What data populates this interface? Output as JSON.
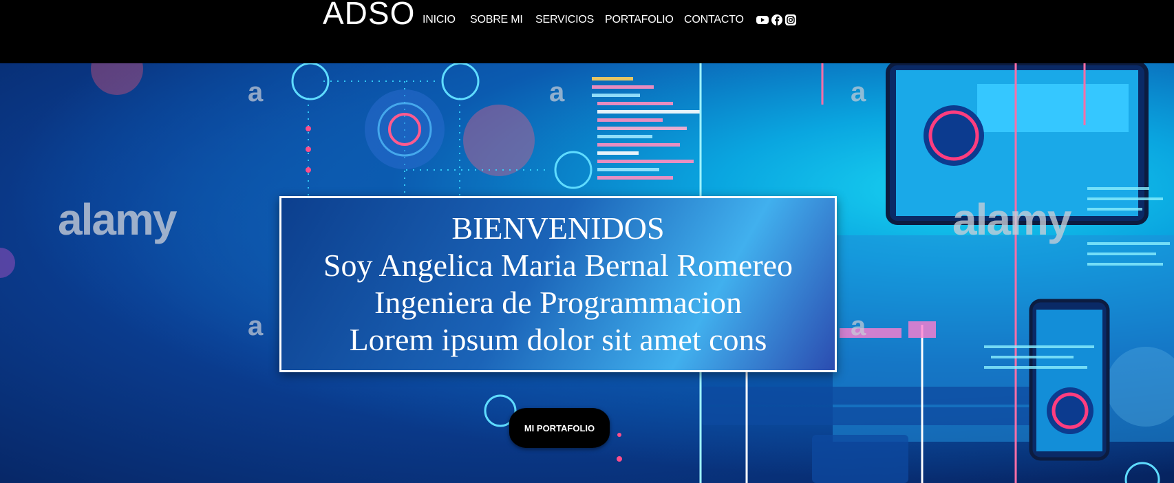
{
  "header": {
    "logo": "ADSO",
    "nav": [
      {
        "label": "INICIO"
      },
      {
        "label": "SOBRE MI"
      },
      {
        "label": "SERVICIOS"
      },
      {
        "label": "PORTAFOLIO"
      },
      {
        "label": "CONTACTO"
      }
    ],
    "social_icons": [
      "youtube-icon",
      "facebook-icon",
      "instagram-icon"
    ]
  },
  "hero": {
    "lines": [
      "BIENVENIDOS",
      "Soy Angelica Maria Bernal Romereo",
      "Ingeniera de Programmacion",
      "Lorem ipsum dolor sit amet cons"
    ],
    "cta_label": "MI PORTAFOLIO",
    "watermark": "alamy",
    "watermark_mark": "a"
  },
  "colors": {
    "header_bg": "#000000",
    "hero_dark": "#06235f",
    "hero_cyan": "#19d4f2",
    "box_border": "#ffffff",
    "neon_pink": "#ff3d7f",
    "button_bg": "#000000"
  }
}
